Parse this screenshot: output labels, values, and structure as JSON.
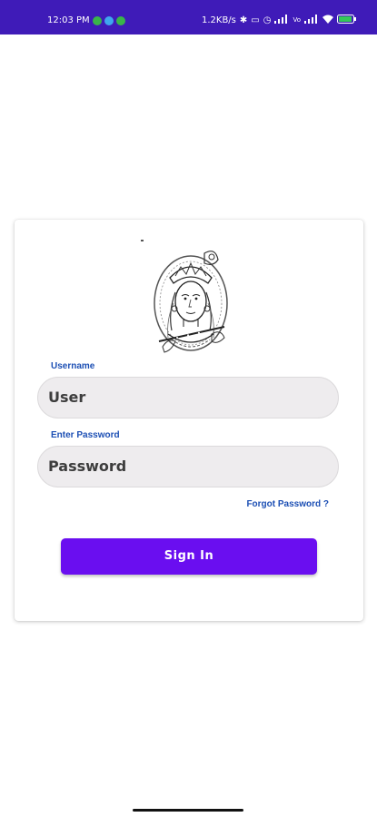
{
  "status_bar": {
    "time": "12:03 PM",
    "network_speed": "1.2KB/s",
    "background_color": "#3f1bb8",
    "notification_icons": [
      "green-app-icon",
      "blue-app-icon",
      "green-app-icon"
    ],
    "system_icons": [
      "bluetooth-icon",
      "vibrate-icon",
      "alarm-icon",
      "signal-icon",
      "signal-icon",
      "wifi-icon",
      "battery-icon"
    ],
    "vo_label": "Vo",
    "lte_label": "WiFi"
  },
  "login": {
    "logo_icon": "krishna-illustration",
    "username_label": "Username",
    "username_placeholder": "User",
    "password_label": "Enter Password",
    "password_placeholder": "Password",
    "forgot_password": "Forgot Password ?",
    "sign_in": "Sign In"
  },
  "colors": {
    "label_blue": "#1c4fb4",
    "button_purple": "#6a0ef0",
    "input_bg": "#eeecee"
  }
}
